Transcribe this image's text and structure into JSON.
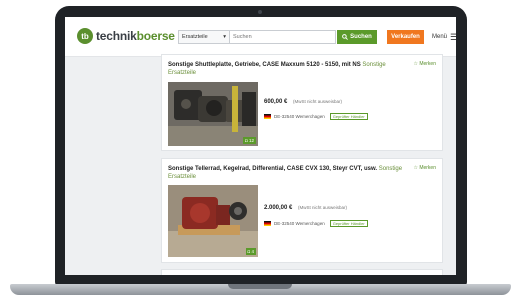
{
  "header": {
    "logo_initial": "tb",
    "logo_part1": "technik",
    "logo_part2": "boerse",
    "category_value": "Ersatzteile",
    "search_placeholder": "Suchen",
    "search_button": "Suchen",
    "sell_button": "Verkaufen",
    "menu_label": "Menü"
  },
  "listings": [
    {
      "title_prefix": "Sonstige",
      "title_main": "Shuttleplatte, Getriebe, CASE Maxxum 5120 - 5150, mit NS",
      "category": "Sonstige Ersatzteile",
      "watch": "Merken",
      "price": "600,00 €",
      "vat_note": "(MwSt nicht ausweisbar)",
      "location": "DE-32540 Wemerchagen",
      "dealer_badge": "Geprüfter Händler",
      "photo_count": "12"
    },
    {
      "title_prefix": "Sonstige",
      "title_main": "Tellerrad, Kegelrad, Differential, CASE CVX 130, Steyr CVT, usw.",
      "category": "Sonstige Ersatzteile",
      "watch": "Merken",
      "price": "2.000,00 €",
      "vat_note": "(MwSt nicht ausweisbar)",
      "location": "DE-32540 Wemerchagen",
      "dealer_badge": "Geprüfter Händler",
      "photo_count": "4"
    }
  ],
  "icons": {
    "search": "search-icon",
    "menu": "hamburger-icon",
    "dropdown": "chevron-down-icon",
    "flag": "de-flag-icon",
    "camera": "camera-icon"
  },
  "colors": {
    "brand_green": "#5b8f2e",
    "sell_orange": "#f0771f"
  }
}
